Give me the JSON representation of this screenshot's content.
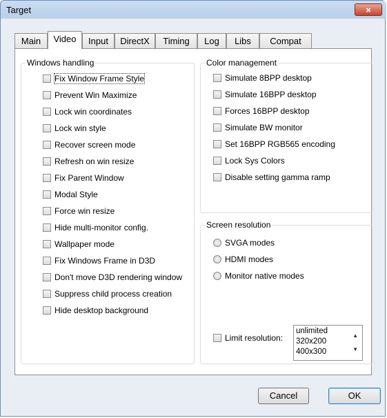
{
  "window": {
    "title": "Target",
    "close_label": "×"
  },
  "tabs": [
    "Main",
    "Video",
    "Input",
    "DirectX",
    "Timing",
    "Log",
    "Libs",
    "Compat"
  ],
  "active_tab": "Video",
  "windows_handling": {
    "title": "Windows handling",
    "options": [
      "Fix Window Frame Style",
      "Prevent Win Maximize",
      "Lock win coordinates",
      "Lock win style",
      "Recover screen mode",
      "Refresh on win resize",
      "Fix Parent Window",
      "Modal Style",
      "Force win resize",
      "Hide multi-monitor config.",
      "Wallpaper mode",
      "Fix Windows Frame in D3D",
      "Don't move D3D rendering window",
      "Suppress child process creation",
      "Hide desktop background"
    ]
  },
  "color_management": {
    "title": "Color management",
    "options": [
      "Simulate 8BPP desktop",
      "Simulate 16BPP desktop",
      "Forces 16BPP desktop",
      "Simulate BW monitor",
      "Set 16BPP RGB565 encoding",
      "Lock Sys Colors",
      "Disable setting gamma ramp"
    ]
  },
  "screen_resolution": {
    "title": "Screen resolution",
    "modes": [
      "SVGA modes",
      "HDMI modes",
      "Monitor native modes"
    ],
    "limit_label": "Limit  resolution:",
    "limit_options": [
      "unlimited",
      "320x200",
      "400x300"
    ]
  },
  "buttons": {
    "cancel": "Cancel",
    "ok": "OK"
  }
}
